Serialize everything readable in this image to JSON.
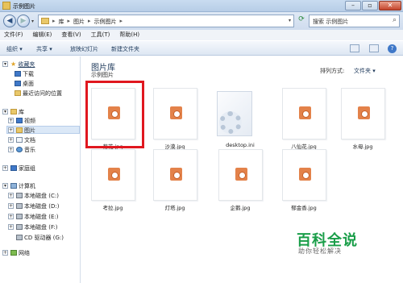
{
  "window": {
    "title": "示例图片"
  },
  "address": {
    "crumbs": [
      "库",
      "图片",
      "示例图片"
    ],
    "search_placeholder": "搜索 示例图片"
  },
  "menu": [
    "文件(F)",
    "编辑(E)",
    "查看(V)",
    "工具(T)",
    "帮助(H)"
  ],
  "toolbar": {
    "organize": "组织 ▾",
    "share": "共享 ▾",
    "slideshow": "放映幻灯片",
    "new_folder": "新建文件夹"
  },
  "nav": {
    "favorites": "收藏夹",
    "downloads": "下载",
    "desktop": "桌面",
    "recent": "最近访问的位置",
    "libraries": "库",
    "videos": "视频",
    "pictures": "图片",
    "documents": "文档",
    "music": "音乐",
    "homegroup": "家庭组",
    "computer": "计算机",
    "drives": [
      "本地磁盘 (C:)",
      "本地磁盘 (D:)",
      "本地磁盘 (E:)",
      "本地磁盘 (F:)",
      "CD 驱动器 (G:)"
    ],
    "network": "网络"
  },
  "library": {
    "title": "图片库",
    "subtitle": "示例图片",
    "sort_label": "排列方式:",
    "sort_value": "文件夹 ▾"
  },
  "files": [
    "菊花.jpg",
    "沙漠.jpg",
    "desktop.ini",
    "八仙花.jpg",
    "水母.jpg",
    "考拉.jpg",
    "灯塔.jpg",
    "企鹅.jpg",
    "郁金香.jpg"
  ],
  "watermark": {
    "title": "百科全说",
    "subtitle": "助你轻松解决"
  },
  "colors": {
    "highlight": "#e0171f",
    "watermark": "#1a9e49"
  }
}
